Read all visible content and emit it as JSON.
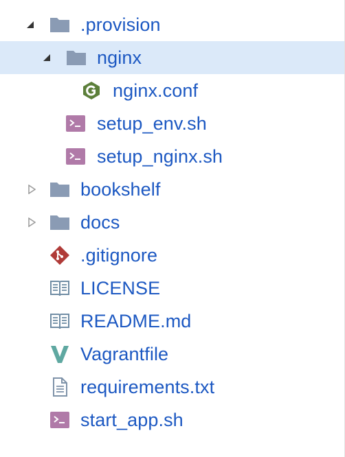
{
  "tree": {
    "items": [
      {
        "label": ".provision",
        "icon": "folder-icon",
        "expanded": true
      },
      {
        "label": "nginx",
        "icon": "folder-icon",
        "expanded": true,
        "selected": true
      },
      {
        "label": "nginx.conf",
        "icon": "nginx-icon"
      },
      {
        "label": "setup_env.sh",
        "icon": "shell-script-icon"
      },
      {
        "label": "setup_nginx.sh",
        "icon": "shell-script-icon"
      },
      {
        "label": "bookshelf",
        "icon": "folder-icon",
        "expanded": false
      },
      {
        "label": "docs",
        "icon": "folder-icon",
        "expanded": false
      },
      {
        "label": ".gitignore",
        "icon": "git-icon"
      },
      {
        "label": "LICENSE",
        "icon": "book-icon"
      },
      {
        "label": "README.md",
        "icon": "book-icon"
      },
      {
        "label": "Vagrantfile",
        "icon": "vagrant-icon"
      },
      {
        "label": "requirements.txt",
        "icon": "text-file-icon"
      },
      {
        "label": "start_app.sh",
        "icon": "shell-script-icon"
      }
    ]
  },
  "colors": {
    "label_text": "#1c58c2",
    "selected_row_bg": "#dbe9f9",
    "folder": "#8a9bb4",
    "shell": "#b07aa8",
    "nginx": "#5c7f3a",
    "git": "#b03b38",
    "book": "#6f8ca4",
    "vagrant": "#5fa8a1",
    "text_file": "#7f93a9",
    "arrow_expanded": "#333333",
    "arrow_collapsed": "#9a9a9a"
  }
}
